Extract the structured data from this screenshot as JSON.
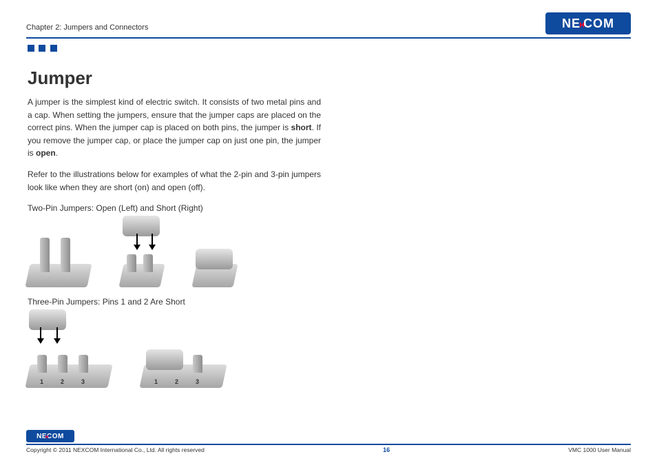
{
  "header": {
    "chapter": "Chapter 2: Jumpers and Connectors",
    "logo_text_1": "NE",
    "logo_text_2": "COM"
  },
  "content": {
    "title": "Jumper",
    "para1_a": "A jumper is the simplest kind of electric switch. It consists of two metal pins and a cap. When setting the jumpers, ensure that the jumper caps are placed on the correct pins. When the jumper cap is placed on both pins, the jumper is ",
    "para1_bold1": "short",
    "para1_b": ". If you remove the jumper cap, or place the jumper cap on just one pin, the jumper is ",
    "para1_bold2": "open",
    "para1_c": ".",
    "para2": "Refer to the illustrations below for examples of what the 2-pin and 3-pin jumpers look like when they are short (on) and open (off).",
    "caption1": "Two-Pin Jumpers: Open (Left) and Short (Right)",
    "caption2": "Three-Pin Jumpers: Pins 1 and 2 Are Short",
    "pin_labels": {
      "p1": "1",
      "p2": "2",
      "p3": "3"
    }
  },
  "footer": {
    "copyright": "Copyright © 2011 NEXCOM International Co., Ltd. All rights reserved",
    "page_number": "16",
    "manual": "VMC 1000 User Manual",
    "logo_text_1": "NE",
    "logo_text_2": "COM"
  }
}
